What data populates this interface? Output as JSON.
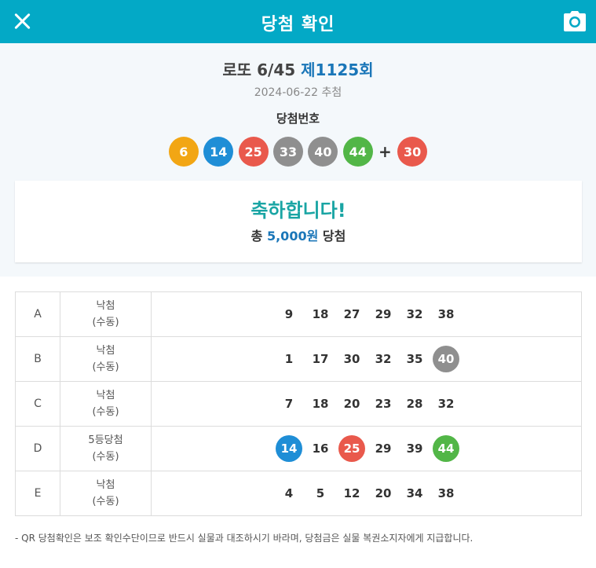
{
  "header": {
    "title": "당첨 확인",
    "close_icon": "close-icon",
    "camera_icon": "camera-icon"
  },
  "colors": {
    "header_bg": "#03a9c6",
    "yellow": "#f2a614",
    "blue": "#1f8ed6",
    "red": "#e9594c",
    "gray": "#8f8f8f",
    "green": "#52b647"
  },
  "draw": {
    "lotto_name": "로또 6/45",
    "round": "제1125회",
    "date": "2024-06-22 추첨",
    "winning_label": "당첨번호",
    "numbers": [
      {
        "n": "6",
        "color": "yellow"
      },
      {
        "n": "14",
        "color": "blue"
      },
      {
        "n": "25",
        "color": "red"
      },
      {
        "n": "33",
        "color": "gray"
      },
      {
        "n": "40",
        "color": "gray"
      },
      {
        "n": "44",
        "color": "green"
      }
    ],
    "plus": "+",
    "bonus": {
      "n": "30",
      "color": "red"
    }
  },
  "result": {
    "congrats": "축하합니다!",
    "prefix": "총",
    "amount": "5,000원",
    "suffix": "당첨"
  },
  "games": [
    {
      "label": "A",
      "result": "낙첨",
      "mode": "(수동)",
      "numbers": [
        {
          "n": "9"
        },
        {
          "n": "18"
        },
        {
          "n": "27"
        },
        {
          "n": "29"
        },
        {
          "n": "32"
        },
        {
          "n": "38"
        }
      ]
    },
    {
      "label": "B",
      "result": "낙첨",
      "mode": "(수동)",
      "numbers": [
        {
          "n": "1"
        },
        {
          "n": "17"
        },
        {
          "n": "30"
        },
        {
          "n": "32"
        },
        {
          "n": "35"
        },
        {
          "n": "40",
          "color": "gray"
        }
      ]
    },
    {
      "label": "C",
      "result": "낙첨",
      "mode": "(수동)",
      "numbers": [
        {
          "n": "7"
        },
        {
          "n": "18"
        },
        {
          "n": "20"
        },
        {
          "n": "23"
        },
        {
          "n": "28"
        },
        {
          "n": "32"
        }
      ]
    },
    {
      "label": "D",
      "result": "5등당첨",
      "mode": "(수동)",
      "numbers": [
        {
          "n": "14",
          "color": "blue"
        },
        {
          "n": "16"
        },
        {
          "n": "25",
          "color": "red"
        },
        {
          "n": "29"
        },
        {
          "n": "39"
        },
        {
          "n": "44",
          "color": "green"
        }
      ]
    },
    {
      "label": "E",
      "result": "낙첨",
      "mode": "(수동)",
      "numbers": [
        {
          "n": "4"
        },
        {
          "n": "5"
        },
        {
          "n": "12"
        },
        {
          "n": "20"
        },
        {
          "n": "34"
        },
        {
          "n": "38"
        }
      ]
    }
  ],
  "notice": "- QR 당첨확인은 보조 확인수단이므로 반드시 실물과 대조하시기 바라며, 당첨금은 실물 복권소지자에게 지급합니다."
}
